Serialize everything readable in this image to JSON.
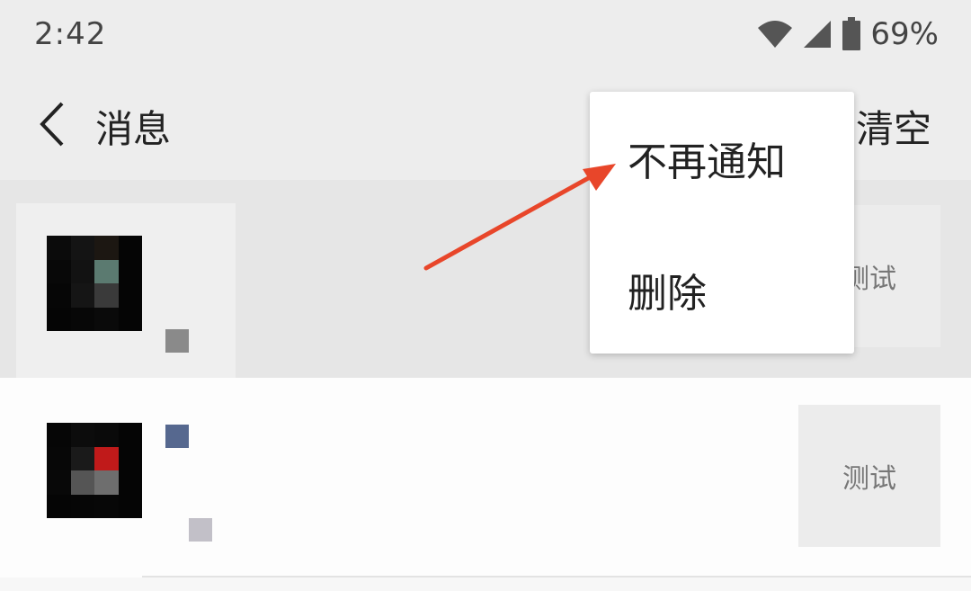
{
  "status_bar": {
    "time": "2:42",
    "battery": "69%",
    "icons": [
      "wifi-icon",
      "signal-icon",
      "battery-icon"
    ]
  },
  "nav": {
    "back_icon": "chevron-left-icon",
    "title": "消息",
    "clear_label": "清空"
  },
  "messages": [
    {
      "thumbnail_text": "测试",
      "highlighted": true
    },
    {
      "thumbnail_text": "测试",
      "highlighted": false
    }
  ],
  "context_menu": {
    "items": [
      {
        "label": "不再通知"
      },
      {
        "label": "删除"
      }
    ]
  },
  "annotation": {
    "color": "#e8462a"
  },
  "colors": {
    "bar_bg": "#ededed",
    "highlight_bg": "#e6e6e6",
    "row_bg": "#fdfdfd"
  }
}
